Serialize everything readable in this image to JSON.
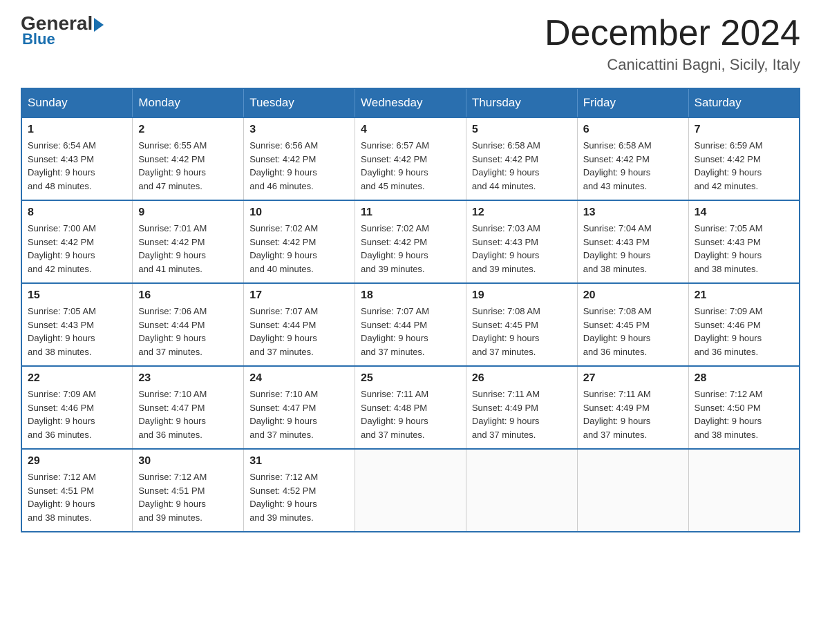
{
  "header": {
    "logo_top": "General",
    "logo_bottom": "Blue",
    "month_title": "December 2024",
    "location": "Canicattini Bagni, Sicily, Italy"
  },
  "days_of_week": [
    "Sunday",
    "Monday",
    "Tuesday",
    "Wednesday",
    "Thursday",
    "Friday",
    "Saturday"
  ],
  "weeks": [
    [
      {
        "day": "1",
        "sunrise": "6:54 AM",
        "sunset": "4:43 PM",
        "daylight": "9 hours and 48 minutes."
      },
      {
        "day": "2",
        "sunrise": "6:55 AM",
        "sunset": "4:42 PM",
        "daylight": "9 hours and 47 minutes."
      },
      {
        "day": "3",
        "sunrise": "6:56 AM",
        "sunset": "4:42 PM",
        "daylight": "9 hours and 46 minutes."
      },
      {
        "day": "4",
        "sunrise": "6:57 AM",
        "sunset": "4:42 PM",
        "daylight": "9 hours and 45 minutes."
      },
      {
        "day": "5",
        "sunrise": "6:58 AM",
        "sunset": "4:42 PM",
        "daylight": "9 hours and 44 minutes."
      },
      {
        "day": "6",
        "sunrise": "6:58 AM",
        "sunset": "4:42 PM",
        "daylight": "9 hours and 43 minutes."
      },
      {
        "day": "7",
        "sunrise": "6:59 AM",
        "sunset": "4:42 PM",
        "daylight": "9 hours and 42 minutes."
      }
    ],
    [
      {
        "day": "8",
        "sunrise": "7:00 AM",
        "sunset": "4:42 PM",
        "daylight": "9 hours and 42 minutes."
      },
      {
        "day": "9",
        "sunrise": "7:01 AM",
        "sunset": "4:42 PM",
        "daylight": "9 hours and 41 minutes."
      },
      {
        "day": "10",
        "sunrise": "7:02 AM",
        "sunset": "4:42 PM",
        "daylight": "9 hours and 40 minutes."
      },
      {
        "day": "11",
        "sunrise": "7:02 AM",
        "sunset": "4:42 PM",
        "daylight": "9 hours and 39 minutes."
      },
      {
        "day": "12",
        "sunrise": "7:03 AM",
        "sunset": "4:43 PM",
        "daylight": "9 hours and 39 minutes."
      },
      {
        "day": "13",
        "sunrise": "7:04 AM",
        "sunset": "4:43 PM",
        "daylight": "9 hours and 38 minutes."
      },
      {
        "day": "14",
        "sunrise": "7:05 AM",
        "sunset": "4:43 PM",
        "daylight": "9 hours and 38 minutes."
      }
    ],
    [
      {
        "day": "15",
        "sunrise": "7:05 AM",
        "sunset": "4:43 PM",
        "daylight": "9 hours and 38 minutes."
      },
      {
        "day": "16",
        "sunrise": "7:06 AM",
        "sunset": "4:44 PM",
        "daylight": "9 hours and 37 minutes."
      },
      {
        "day": "17",
        "sunrise": "7:07 AM",
        "sunset": "4:44 PM",
        "daylight": "9 hours and 37 minutes."
      },
      {
        "day": "18",
        "sunrise": "7:07 AM",
        "sunset": "4:44 PM",
        "daylight": "9 hours and 37 minutes."
      },
      {
        "day": "19",
        "sunrise": "7:08 AM",
        "sunset": "4:45 PM",
        "daylight": "9 hours and 37 minutes."
      },
      {
        "day": "20",
        "sunrise": "7:08 AM",
        "sunset": "4:45 PM",
        "daylight": "9 hours and 36 minutes."
      },
      {
        "day": "21",
        "sunrise": "7:09 AM",
        "sunset": "4:46 PM",
        "daylight": "9 hours and 36 minutes."
      }
    ],
    [
      {
        "day": "22",
        "sunrise": "7:09 AM",
        "sunset": "4:46 PM",
        "daylight": "9 hours and 36 minutes."
      },
      {
        "day": "23",
        "sunrise": "7:10 AM",
        "sunset": "4:47 PM",
        "daylight": "9 hours and 36 minutes."
      },
      {
        "day": "24",
        "sunrise": "7:10 AM",
        "sunset": "4:47 PM",
        "daylight": "9 hours and 37 minutes."
      },
      {
        "day": "25",
        "sunrise": "7:11 AM",
        "sunset": "4:48 PM",
        "daylight": "9 hours and 37 minutes."
      },
      {
        "day": "26",
        "sunrise": "7:11 AM",
        "sunset": "4:49 PM",
        "daylight": "9 hours and 37 minutes."
      },
      {
        "day": "27",
        "sunrise": "7:11 AM",
        "sunset": "4:49 PM",
        "daylight": "9 hours and 37 minutes."
      },
      {
        "day": "28",
        "sunrise": "7:12 AM",
        "sunset": "4:50 PM",
        "daylight": "9 hours and 38 minutes."
      }
    ],
    [
      {
        "day": "29",
        "sunrise": "7:12 AM",
        "sunset": "4:51 PM",
        "daylight": "9 hours and 38 minutes."
      },
      {
        "day": "30",
        "sunrise": "7:12 AM",
        "sunset": "4:51 PM",
        "daylight": "9 hours and 39 minutes."
      },
      {
        "day": "31",
        "sunrise": "7:12 AM",
        "sunset": "4:52 PM",
        "daylight": "9 hours and 39 minutes."
      },
      null,
      null,
      null,
      null
    ]
  ],
  "labels": {
    "sunrise": "Sunrise:",
    "sunset": "Sunset:",
    "daylight": "Daylight:"
  }
}
